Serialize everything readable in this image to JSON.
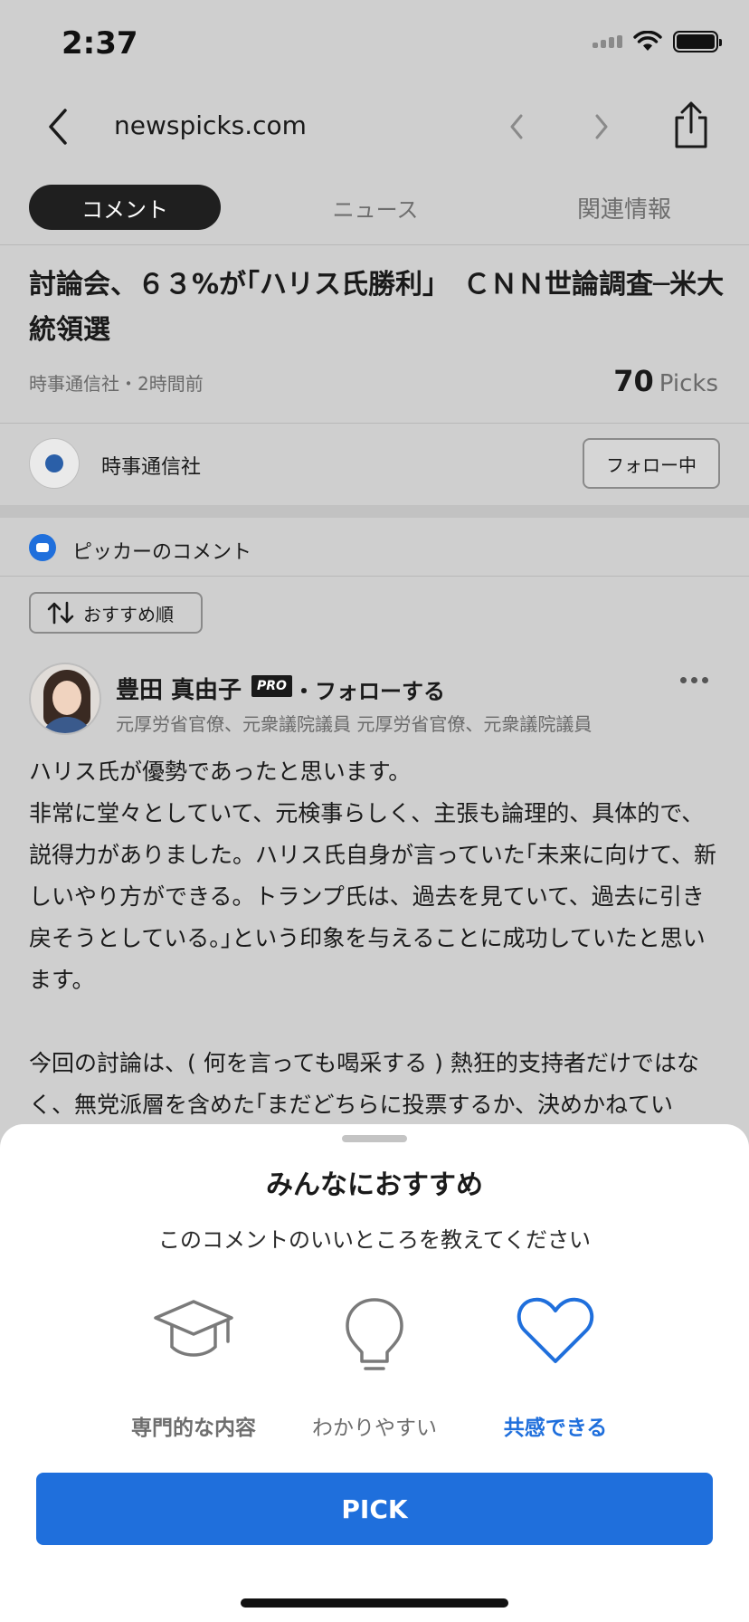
{
  "status_bar": {
    "time": "2:37"
  },
  "browser": {
    "url": "newspicks.com"
  },
  "tabs": [
    {
      "label": "コメント",
      "active": true
    },
    {
      "label": "ニュース",
      "active": false
    },
    {
      "label": "関連情報",
      "active": false
    }
  ],
  "article": {
    "title": "討論会、６３%が｢ハリス氏勝利｣　ＣＮＮ世論調査─米大統領選",
    "source_time": "時事通信社・2時間前",
    "picks_count": "70",
    "picks_label": "Picks"
  },
  "publisher": {
    "name": "時事通信社",
    "follow_label": "フォロー中"
  },
  "comments_section": {
    "label": "ピッカーのコメント",
    "sort_label": "おすすめ順"
  },
  "comment": {
    "author": "豊田 真由子",
    "badge": "PRO",
    "follow_label": "・フォローする",
    "author_title": "元厚労省官僚、元衆議院議員 元厚労省官僚、元衆議院議員",
    "paragraph1": "ハリス氏が優勢であったと思います。\n非常に堂々としていて、元検事らしく、主張も論理的、具体的で、説得力がありました。ハリス氏自身が言っていた｢未来に向けて、新しいやり方ができる。トランプ氏は、過去を見ていて、過去に引き戻そうとしている。｣という印象を与えることに成功していたと思います。",
    "paragraph2": "今回の討論は、( 何を言っても喝采する ) 熱狂的支持者だけではなく、無党派層を含めた｢まだどちらに投票するか、決めかねてい"
  },
  "sheet": {
    "title": "みんなにおすすめ",
    "subtitle": "このコメントのいいところを教えてください",
    "options": [
      {
        "label": "専門的な内容",
        "icon": "graduation-cap-icon",
        "selected": false
      },
      {
        "label": "わかりやすい",
        "icon": "lightbulb-icon",
        "selected": false
      },
      {
        "label": "共感できる",
        "icon": "heart-icon",
        "selected": true
      }
    ],
    "pick_label": "PICK"
  },
  "colors": {
    "accent": "#1f6fdc",
    "overlay_bg": "#cfcfcf",
    "sheet_bg": "#ffffff",
    "active_tab_bg": "#1f1f1f"
  }
}
